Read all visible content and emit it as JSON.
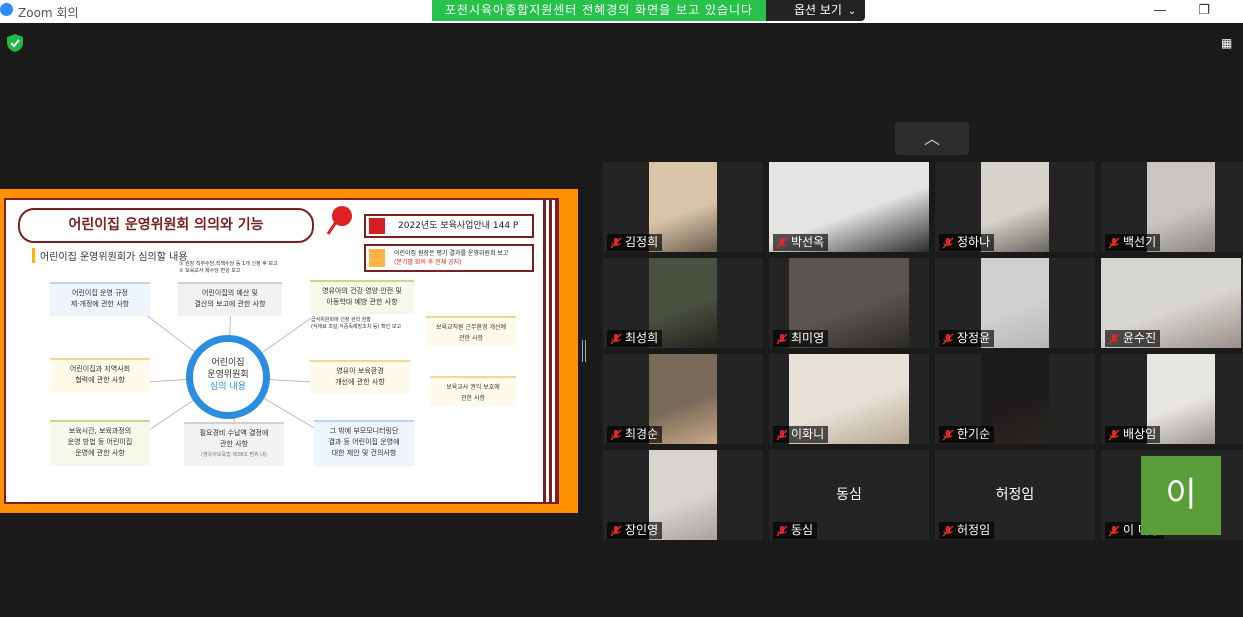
{
  "titlebar": {
    "app_title": "Zoom 회의",
    "minimize": "—",
    "restore": "❐",
    "close": "✕"
  },
  "share_banner": {
    "text": "포천시육아종합지원센터 전혜경의 화면을 보고 있습니다",
    "view_options": "옵션 보기",
    "view_options_icon": "chevron-down-icon"
  },
  "colors": {
    "share_green": "#27c24a",
    "muted_red": "#d42020",
    "avatar_green": "#5a9e3a"
  },
  "slide": {
    "title": "어린이집 운영위원회 의의와 기능",
    "ref1": "2022년도 보육사업안내 144 P",
    "ref2_line1": "어린이집 원장은 평가 결과를 운영위원회 보고",
    "ref2_line2": "(분기별 회의 후 전체 공지)",
    "subtitle": "어린이집 운영위원회가 심의할 내용",
    "circle_line1": "어린이집",
    "circle_line2": "운영위원회",
    "circle_line3": "심의 내용",
    "box_rules_1": "어린이집 운영 규정",
    "box_rules_2": "제·개정에 관한 사항",
    "box_budget_1": "어린이집의 예산 및",
    "box_budget_2": "결산의 보고에 관한 사항",
    "budget_note_1": "① 원장 직무수당,직책수당 등 1개 신청 후 보고",
    "budget_note_2": "② 보육교사 제수당 편성 보고",
    "box_health_1": "영유아의 건강·영양·안전 및",
    "box_health_2": "아동학대 예방 관한 사항",
    "health_note_1": "급식위원회에 선정 관리 현황",
    "health_note_2": "(식재료 조달,식중독예방조치 등) 확인 보고",
    "box_teacher_env_1": "보육교직원 근무환경 개선에",
    "box_teacher_env_2": "관한 사항",
    "box_community_1": "어린이집과 지역사회",
    "box_community_2": "협력에 관한 사항",
    "box_infant_env_1": "영유아 보육환경",
    "box_infant_env_2": "개선에 관한 사항",
    "box_teacher_rights_1": "보육교사 권익 보호에",
    "box_teacher_rights_2": "관한 사항",
    "box_hours_1": "보육시간, 보육과정의",
    "box_hours_2": "운영 방법 등 어린이집",
    "box_hours_3": "운영에 관한 사항",
    "box_fees_1": "필요경비 수납액 결정에",
    "box_fees_2": "관한 사항",
    "fees_note": "(영유아보육법 제38조 범위 내)",
    "box_monitor_1": "그 밖에 부모모니터링단",
    "box_monitor_2": "결과 등 어린이집 운영에",
    "box_monitor_3": "대한 제안 및 건의사항"
  },
  "gallery": {
    "collapse_icon": "chevron-up-icon",
    "participants": [
      {
        "name": "김정희",
        "muted": true,
        "video": true
      },
      {
        "name": "박선옥",
        "muted": true,
        "video": true
      },
      {
        "name": "정하나",
        "muted": true,
        "video": true
      },
      {
        "name": "백선기",
        "muted": true,
        "video": true
      },
      {
        "name": "최성희",
        "muted": true,
        "video": true
      },
      {
        "name": "최미영",
        "muted": true,
        "video": true
      },
      {
        "name": "장정윤",
        "muted": true,
        "video": true
      },
      {
        "name": "윤수진",
        "muted": true,
        "video": true
      },
      {
        "name": "최경순",
        "muted": true,
        "video": true
      },
      {
        "name": "이화니",
        "muted": true,
        "video": true
      },
      {
        "name": "한기순",
        "muted": true,
        "video": true
      },
      {
        "name": "배상임",
        "muted": true,
        "video": true
      },
      {
        "name": "장인영",
        "muted": true,
        "video": true
      },
      {
        "name": "동심",
        "muted": true,
        "video": false
      },
      {
        "name": "허정임",
        "muted": true,
        "video": false
      },
      {
        "name": "이 미영",
        "muted": true,
        "video": false,
        "avatar_letter": "이"
      }
    ]
  }
}
